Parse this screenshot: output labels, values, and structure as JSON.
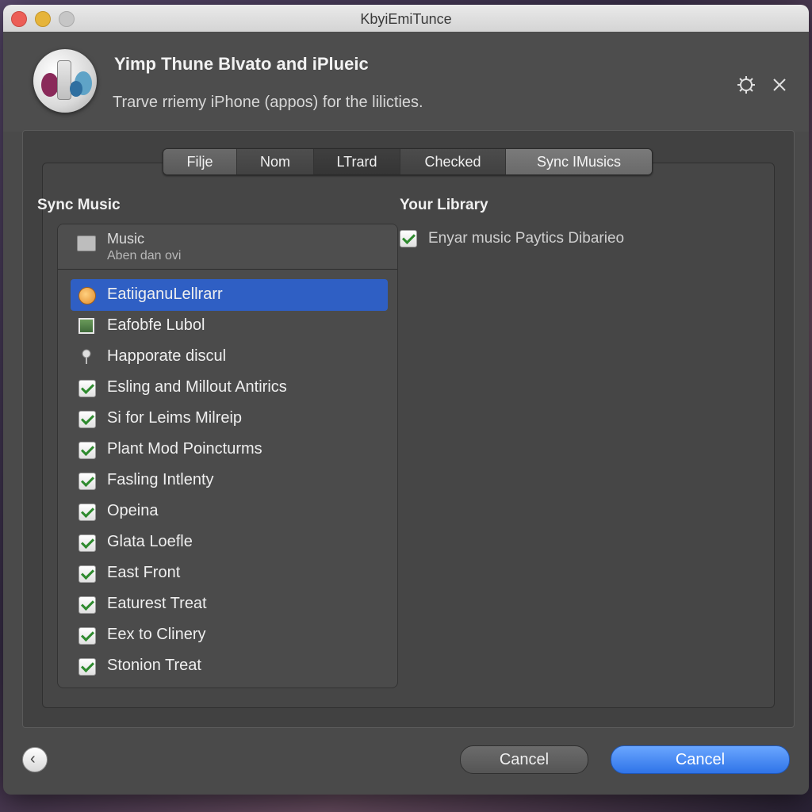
{
  "window": {
    "title": "KbyiEmiTunce"
  },
  "header": {
    "title": "Yimp Thune Blvato and iPlueic",
    "subtitle": "Trarve rriemy iPhone (appos) for the lilicties."
  },
  "tabs": [
    {
      "label": "Filje"
    },
    {
      "label": "Nom"
    },
    {
      "label": "LTrard"
    },
    {
      "label": "Checked"
    },
    {
      "label": "Sync IMusics"
    }
  ],
  "sync_music": {
    "title": "Sync Music",
    "list_header": {
      "label": "Music",
      "sublabel": "Aben dan ovi"
    },
    "items": [
      {
        "label": "EatiiganuLellrarr",
        "icon": "orange-circle-icon",
        "checked": null,
        "selected": true
      },
      {
        "label": "Eafobfe Lubol",
        "icon": "photo-icon",
        "checked": null,
        "selected": false
      },
      {
        "label": "Happorate discul",
        "icon": "pin-icon",
        "checked": null,
        "selected": false
      },
      {
        "label": "Esling and Millout Antirics",
        "checked": true
      },
      {
        "label": "Si for Leims Milreip",
        "checked": true
      },
      {
        "label": "Plant Mod Poincturms",
        "checked": true
      },
      {
        "label": "Fasling Intlenty",
        "checked": true
      },
      {
        "label": "Opeina",
        "checked": true
      },
      {
        "label": "Glata Loefle",
        "checked": true
      },
      {
        "label": "East Front",
        "checked": true
      },
      {
        "label": "Eaturest Treat",
        "checked": true
      },
      {
        "label": "Eex to Clinery",
        "checked": true
      },
      {
        "label": "Stonion Treat",
        "checked": true
      }
    ]
  },
  "library": {
    "title": "Your Library",
    "option": {
      "label": "Enyar music Paytics Dibarieo",
      "checked": true
    }
  },
  "footer": {
    "secondary_label": "Cancel",
    "primary_label": "Cancel"
  },
  "colors": {
    "accent": "#2f74e8",
    "selection": "#2f5fc4",
    "check": "#2e8a2e"
  }
}
